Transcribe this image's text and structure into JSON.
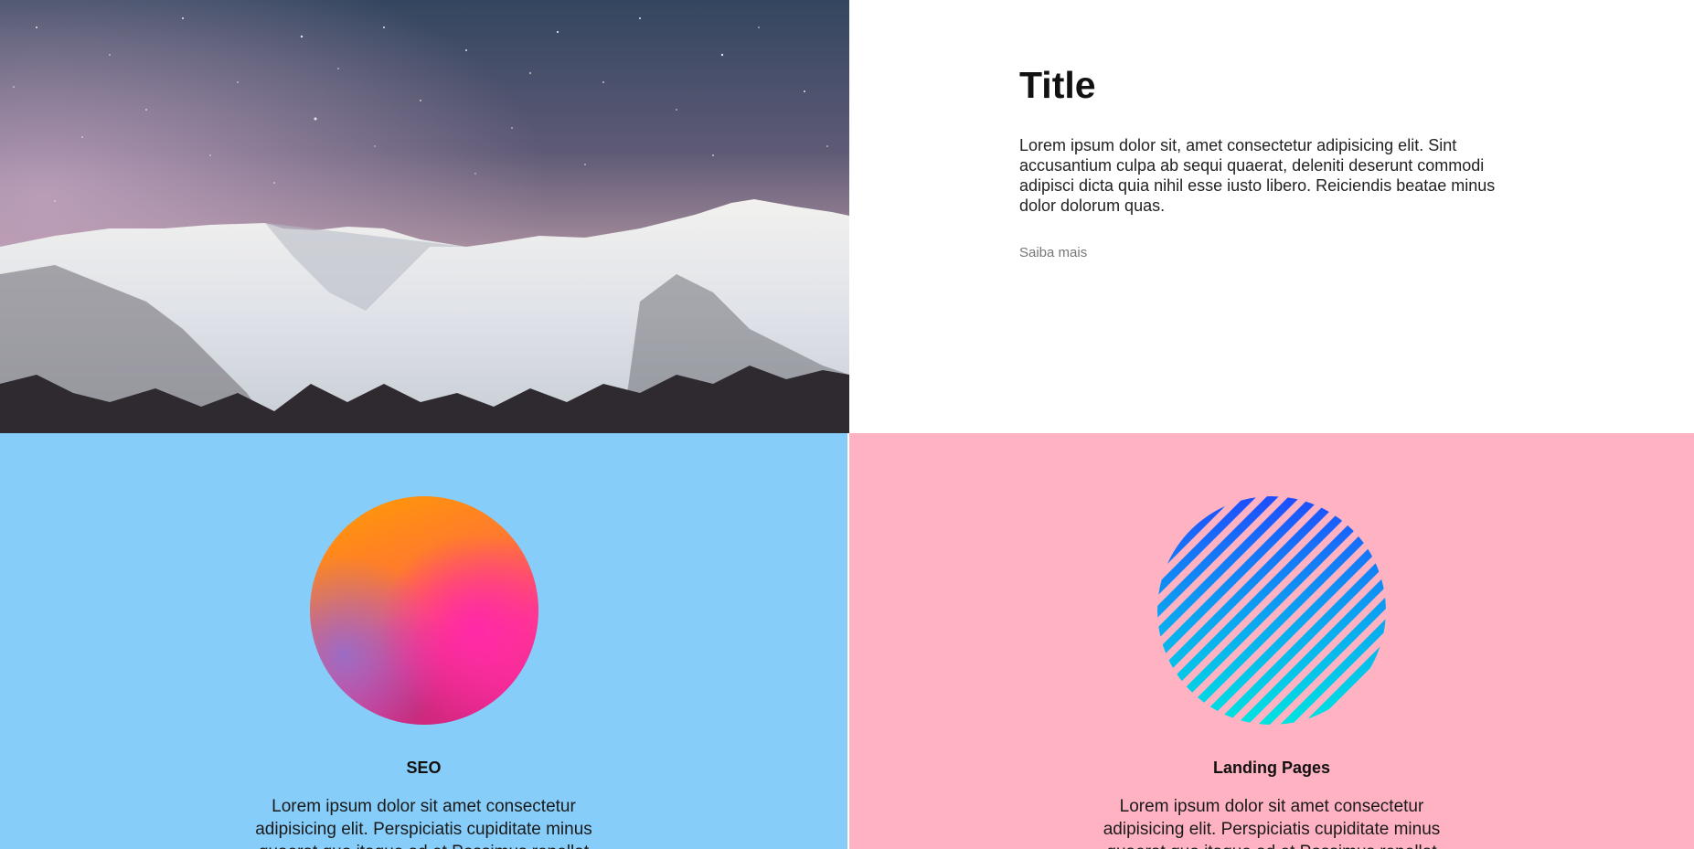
{
  "hero": {
    "title": "Title",
    "body": "Lorem ipsum dolor sit, amet consectetur adipisicing elit. Sint accusantium culpa ab sequi quaerat, deleniti deserunt commodi adipisci dicta quia nihil esse iusto libero. Reiciendis beatae minus dolor dolorum quas.",
    "link_label": "Saiba mais"
  },
  "cards": [
    {
      "title": "SEO",
      "text": "Lorem ipsum dolor sit amet consectetur adipisicing elit. Perspiciatis cupiditate minus quaerat quo itaque ad et Possimus repellat",
      "background": "#87cdf9"
    },
    {
      "title": "Landing Pages",
      "text": "Lorem ipsum dolor sit amet consectetur adipisicing elit. Perspiciatis cupiditate minus quaerat quo itaque ad et Possimus repellat",
      "background": "#ffb3c2"
    }
  ],
  "colors": {
    "gradient_orb": [
      "#ff9d00",
      "#ff3a8a",
      "#e61f9a"
    ],
    "stripes": [
      "#1e5bff",
      "#00e0e6"
    ]
  }
}
